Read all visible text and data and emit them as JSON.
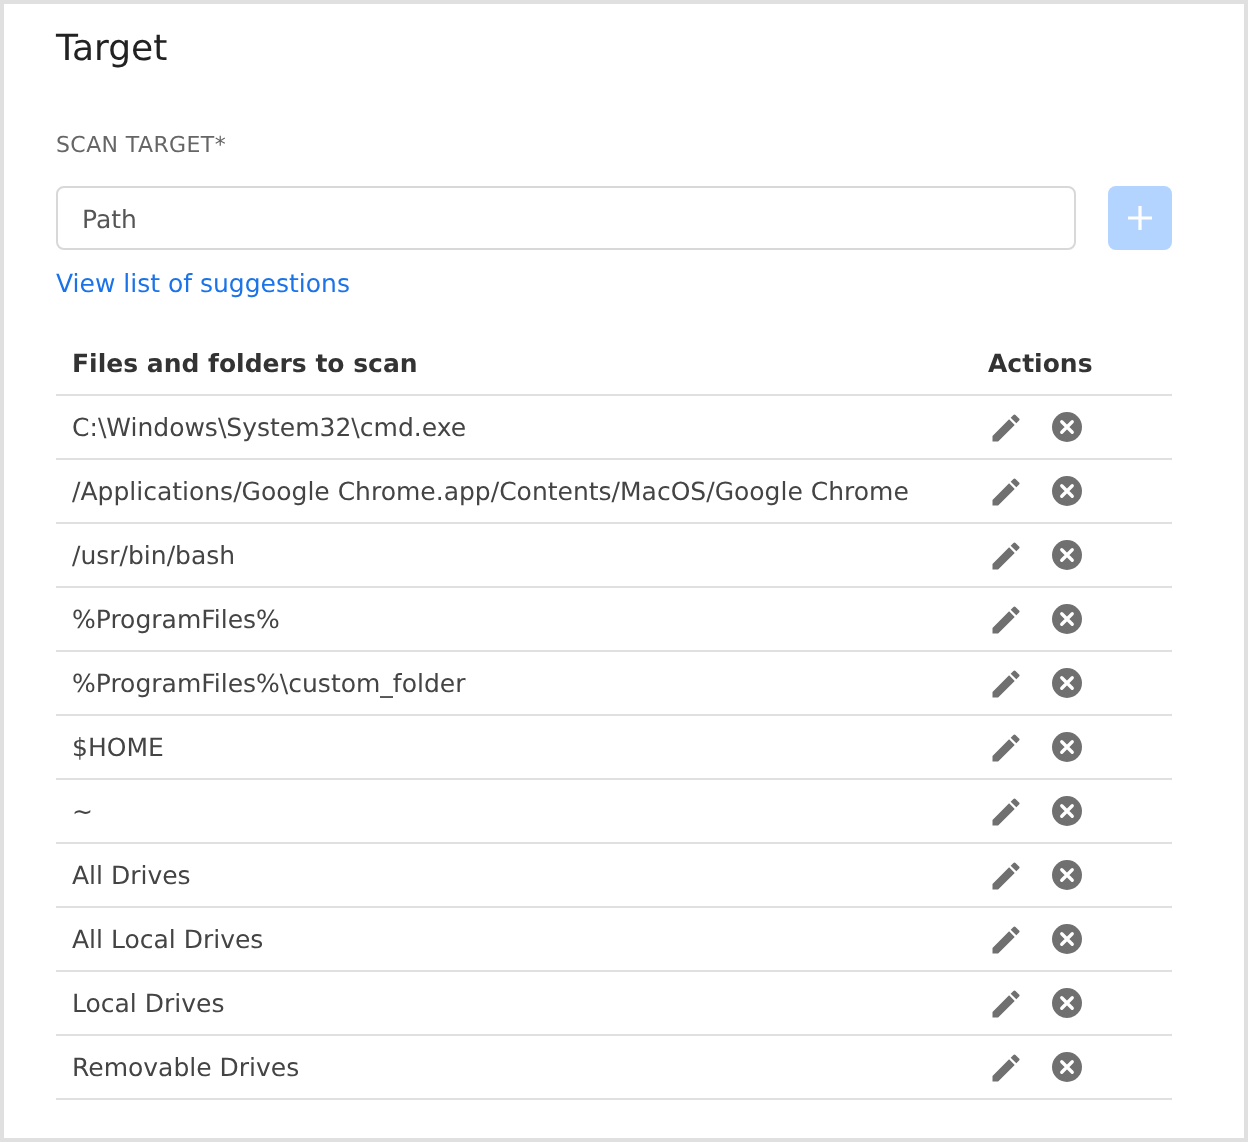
{
  "title": "Target",
  "scan_target": {
    "label": "SCAN TARGET*",
    "placeholder": "Path",
    "add_button": {
      "disabled": true
    },
    "suggestions_link": "View list of suggestions"
  },
  "table": {
    "columns": [
      "Files and folders to scan",
      "Actions"
    ],
    "rows": [
      {
        "path": "C:\\Windows\\System32\\cmd.exe"
      },
      {
        "path": "/Applications/Google Chrome.app/Contents/MacOS/Google Chrome"
      },
      {
        "path": "/usr/bin/bash"
      },
      {
        "path": "%ProgramFiles%"
      },
      {
        "path": "%ProgramFiles%\\custom_folder"
      },
      {
        "path": "$HOME"
      },
      {
        "path": "~"
      },
      {
        "path": "All Drives"
      },
      {
        "path": "All Local Drives"
      },
      {
        "path": "Local Drives"
      },
      {
        "path": "Removable Drives"
      }
    ]
  }
}
